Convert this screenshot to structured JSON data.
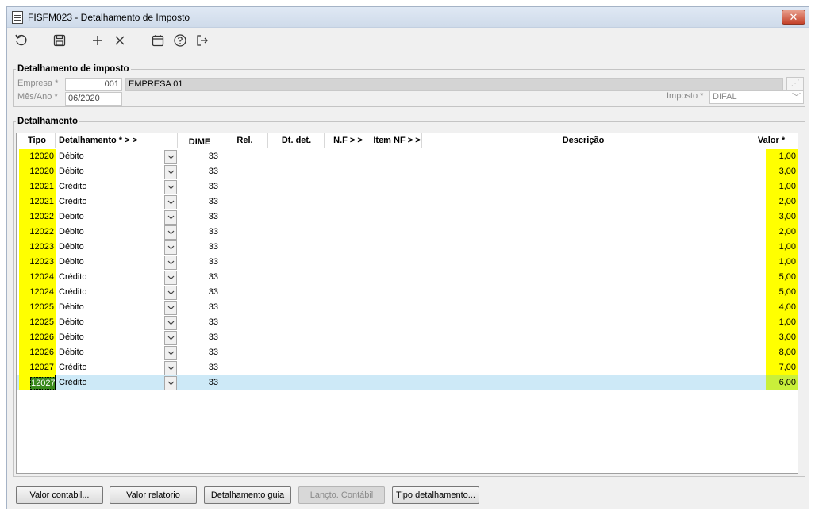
{
  "window": {
    "title": "FISFM023 - Detalhamento de Imposto",
    "close_label": "✕"
  },
  "toolbar": {
    "icons": [
      "refresh-icon",
      "save-icon",
      "add-icon",
      "delete-icon",
      "calendar-icon",
      "help-icon",
      "exit-icon"
    ]
  },
  "header": {
    "legend": "Detalhamento de imposto",
    "empresa_label": "Empresa *",
    "empresa_code": "001",
    "empresa_name": "EMPRESA 01",
    "mesano_label": "Mês/Ano *",
    "mesano_value": "06/2020",
    "imposto_label": "Imposto *",
    "imposto_value": "DIFAL"
  },
  "details": {
    "legend": "Detalhamento",
    "columns": {
      "tipo": "Tipo",
      "detalhamento": "Detalhamento *  > >",
      "dime": "DIME",
      "rel": "Rel.",
      "dt_det": "Dt. det.",
      "nf": "N.F  > >",
      "item_nf": "Item NF > >",
      "descricao": "Descrição",
      "valor": "Valor *"
    },
    "rows": [
      {
        "tipo": "12020",
        "det": "Débito",
        "dime": "33",
        "valor": "1,00"
      },
      {
        "tipo": "12020",
        "det": "Débito",
        "dime": "33",
        "valor": "3,00"
      },
      {
        "tipo": "12021",
        "det": "Crédito",
        "dime": "33",
        "valor": "1,00"
      },
      {
        "tipo": "12021",
        "det": "Crédito",
        "dime": "33",
        "valor": "2,00"
      },
      {
        "tipo": "12022",
        "det": "Débito",
        "dime": "33",
        "valor": "3,00"
      },
      {
        "tipo": "12022",
        "det": "Débito",
        "dime": "33",
        "valor": "2,00"
      },
      {
        "tipo": "12023",
        "det": "Débito",
        "dime": "33",
        "valor": "1,00"
      },
      {
        "tipo": "12023",
        "det": "Débito",
        "dime": "33",
        "valor": "1,00"
      },
      {
        "tipo": "12024",
        "det": "Crédito",
        "dime": "33",
        "valor": "5,00"
      },
      {
        "tipo": "12024",
        "det": "Crédito",
        "dime": "33",
        "valor": "5,00"
      },
      {
        "tipo": "12025",
        "det": "Débito",
        "dime": "33",
        "valor": "4,00"
      },
      {
        "tipo": "12025",
        "det": "Débito",
        "dime": "33",
        "valor": "1,00"
      },
      {
        "tipo": "12026",
        "det": "Débito",
        "dime": "33",
        "valor": "3,00"
      },
      {
        "tipo": "12026",
        "det": "Débito",
        "dime": "33",
        "valor": "8,00"
      },
      {
        "tipo": "12027",
        "det": "Crédito",
        "dime": "33",
        "valor": "7,00"
      },
      {
        "tipo": "12027",
        "det": "Crédito",
        "dime": "33",
        "valor": "6,00",
        "selected": true
      }
    ]
  },
  "buttons": {
    "valor_contabil": "Valor contabil...",
    "valor_relatorio": "Valor relatorio",
    "detalhamento_guia": "Detalhamento guia",
    "lancto_contabil": "Lançto. Contábil",
    "tipo_detalhamento": "Tipo detalhamento..."
  }
}
